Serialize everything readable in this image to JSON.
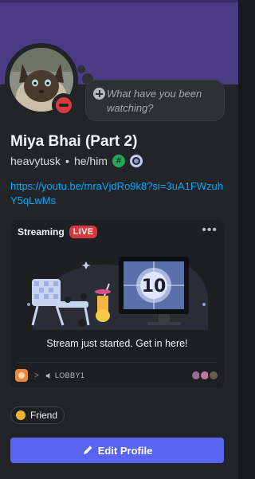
{
  "status_bubble": {
    "placeholder": "What have you been watching?",
    "icon": "plus-circle-icon"
  },
  "user": {
    "display_name": "Miya Bhai (Part 2)",
    "username": "heavytusk",
    "separator": "•",
    "pronouns": "he/him",
    "status": "do-not-disturb",
    "badges": [
      {
        "icon": "hashtag-badge-icon",
        "glyph": "#"
      },
      {
        "icon": "nitro-badge-icon"
      }
    ]
  },
  "bio_link": "https://youtu.be/mraVjdRo9k8?si=3uA1FWzuhY5qLwMs",
  "activity": {
    "title": "Streaming",
    "badge": "LIVE",
    "more_icon": "more-horizontal-icon",
    "caption": "Stream just started. Get in here!",
    "channel": "LOBBY1",
    "chevron": ">",
    "art_text": "10",
    "colors": {
      "live": "#da373c",
      "tv_screen": "#7e8fbf",
      "chair": "#c9d3f2"
    }
  },
  "friend_chip": {
    "label": "Friend",
    "dot_color": "#f0b232"
  },
  "edit_button": {
    "label": "Edit Profile",
    "icon": "pencil-icon"
  },
  "colors": {
    "banner": "#4a3b85",
    "accent": "#5865f2",
    "link": "#00a8fc",
    "card": "#232428"
  }
}
